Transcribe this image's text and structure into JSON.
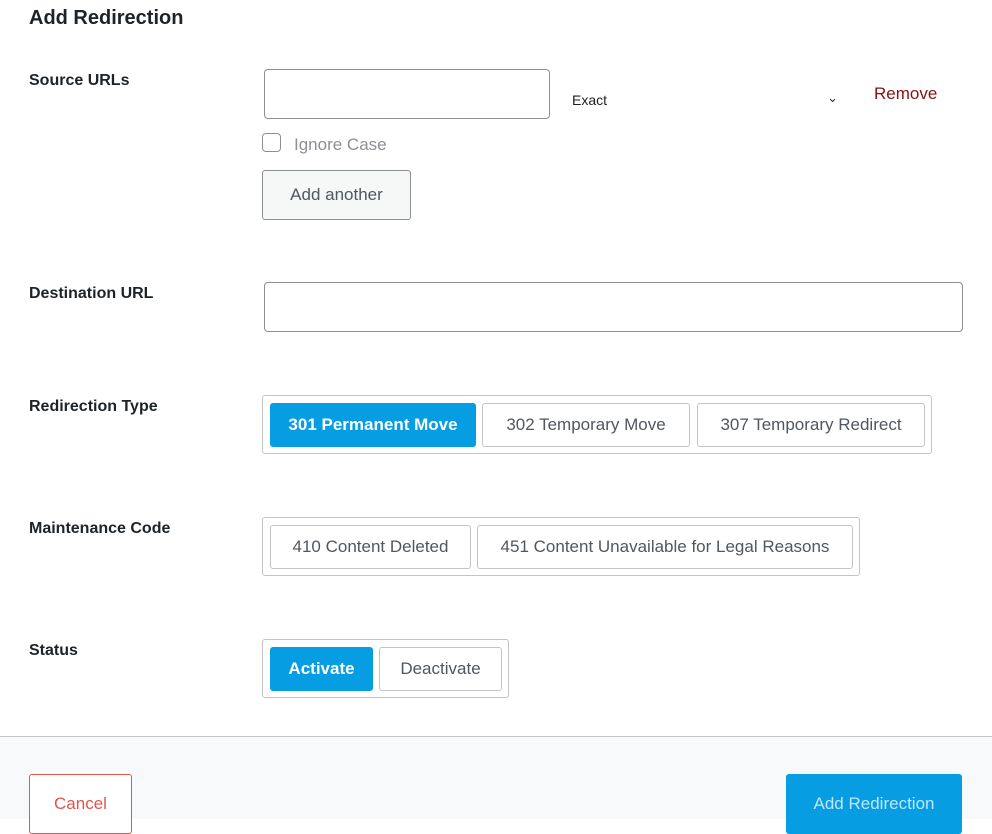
{
  "title": "Add Redirection",
  "source": {
    "label": "Source URLs",
    "value": "",
    "match_type": "Exact",
    "remove": "Remove",
    "ignore_case": "Ignore Case",
    "ignore_case_checked": false,
    "add_another": "Add another"
  },
  "destination": {
    "label": "Destination URL",
    "value": ""
  },
  "redirection_type": {
    "label": "Redirection Type",
    "options": [
      "301 Permanent Move",
      "302 Temporary Move",
      "307 Temporary Redirect"
    ],
    "selected": "301 Permanent Move"
  },
  "maintenance": {
    "label": "Maintenance Code",
    "options": [
      "410 Content Deleted",
      "451 Content Unavailable for Legal Reasons"
    ]
  },
  "status": {
    "label": "Status",
    "options": [
      "Activate",
      "Deactivate"
    ],
    "selected": "Activate"
  },
  "footer": {
    "cancel": "Cancel",
    "submit": "Add Redirection"
  },
  "colors": {
    "accent": "#069de3",
    "remove": "#8a1010",
    "cancel": "#e2554a"
  }
}
